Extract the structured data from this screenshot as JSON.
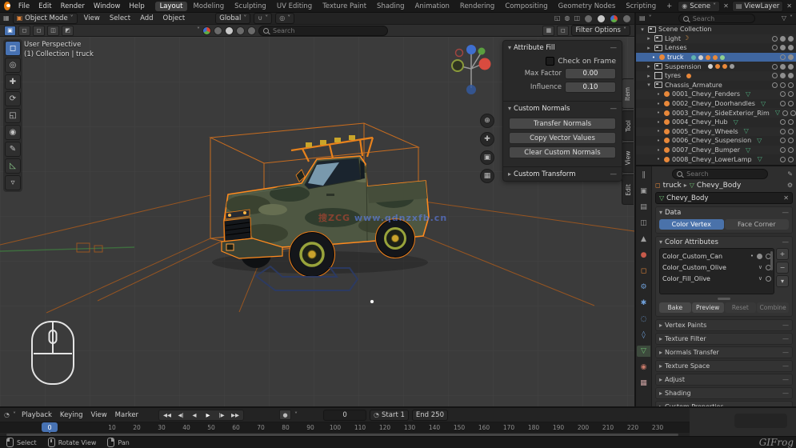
{
  "colors": {
    "accent_blue": "#4772b3",
    "selection_orange": "#ff8a1e",
    "mesh_green": "#6fbf73"
  },
  "icons": {
    "chev": "˅",
    "drop": "▾",
    "disc_open": "▾",
    "disc_closed": "▸",
    "dot": "•",
    "close": "✕",
    "plus": "+",
    "minus": "−",
    "dash": "—",
    "mesh": "▽",
    "moon": "☽",
    "check": "∨",
    "gear": "⚙",
    "pencil": "✎",
    "grid": "▦",
    "square": "▣",
    "layers": "▤",
    "panel": "◫",
    "tri": "▲",
    "circle": "●",
    "ring": "◌",
    "diamond": "◊",
    "sphereglyph": "◉",
    "star": "✱",
    "bars": "∥",
    "boxsel": "◻",
    "cursor": "◎",
    "move": "✚",
    "rotate": "⟳",
    "scale": "◱",
    "transform": "◉",
    "annotate": "✎",
    "measure": "◺",
    "addcube": "▿",
    "zoom": "⊕",
    "pan": "✚",
    "camera": "▣",
    "ortho": "▦",
    "jump_start": "◀◀",
    "prev_key": "◀|",
    "play_back": "◀",
    "play": "▶",
    "next_key": "|▶",
    "jump_end": "▶▶",
    "record": "●",
    "xray": "◫",
    "gizmo_toggle": "◱",
    "overlays": "◍",
    "magnet": "∪",
    "prop_edit": "◎",
    "clock": "◔",
    "filter": "▽",
    "handle": "≡"
  },
  "topbar": {
    "menus": [
      "File",
      "Edit",
      "Render",
      "Window",
      "Help"
    ],
    "tabs": [
      "Layout",
      "Modeling",
      "Sculpting",
      "UV Editing",
      "Texture Paint",
      "Shading",
      "Animation",
      "Rendering",
      "Compositing",
      "Geometry Nodes",
      "Scripting"
    ],
    "add_tab": "+",
    "scene_label": "Scene",
    "view_layer_label": "ViewLayer"
  },
  "viewport_header": {
    "mode": "Object Mode",
    "menus": [
      "View",
      "Select",
      "Add",
      "Object"
    ],
    "orientation": "Global"
  },
  "tool_settings": {
    "search_placeholder": "Search",
    "filter_label": "Filter Options"
  },
  "viewport": {
    "view_label": "User Perspective",
    "collection_label": "(1) Collection | truck",
    "watermark_cn": "搜ZCG",
    "watermark_url": "www.qdnzxfb.cn",
    "npanel_tabs": [
      "Item",
      "Tool",
      "View",
      "Edit"
    ]
  },
  "float_panel": {
    "section1": {
      "title": "Attribute Fill",
      "checkbox_label": "Check on Frame",
      "fields": [
        {
          "label": "Max Factor",
          "value": "0.00"
        },
        {
          "label": "Influence",
          "value": "0.10"
        }
      ]
    },
    "section2": {
      "title": "Custom Normals",
      "buttons": [
        "Transfer Normals",
        "Copy Vector Values",
        "Clear Custom Normals"
      ]
    },
    "section3": {
      "title": "Custom Transform"
    }
  },
  "outliner": {
    "search_placeholder": "Search",
    "rows": [
      {
        "label": "Scene Collection"
      },
      {
        "label": "Light"
      },
      {
        "label": "Lenses"
      },
      {
        "label": "truck"
      },
      {
        "label": "Suspension"
      },
      {
        "label": "tyres"
      },
      {
        "label": "Chassis_Armature"
      },
      {
        "label": "0001_Chevy_Fenders"
      },
      {
        "label": "0002_Chevy_Doorhandles"
      },
      {
        "label": "0003_Chevy_SideExterior_Rim"
      },
      {
        "label": "0004_Chevy_Hub"
      },
      {
        "label": "0005_Chevy_Wheels"
      },
      {
        "label": "0006_Chevy_Suspension"
      },
      {
        "label": "0007_Chevy_Bumper"
      },
      {
        "label": "0008_Chevy_LowerLamp"
      }
    ]
  },
  "properties": {
    "search_placeholder": "Search",
    "breadcrumb_object": "truck",
    "breadcrumb_data": "Chevy_Body",
    "name_field": "Chevy_Body",
    "section_data": {
      "title": "Data",
      "segments": [
        "Color Vertex",
        "Face Corner"
      ]
    },
    "section_attributes": {
      "title": "Color Attributes",
      "items": [
        "Color_Custom_Can",
        "Color_Custom_Olive",
        "Color_Fill_Olive"
      ],
      "buttons": [
        "Bake",
        "Preview",
        "Reset",
        "Combine"
      ]
    },
    "collapsed_sections": [
      "Vertex Paints",
      "Texture Filter",
      "Normals Transfer",
      "Texture Space",
      "Adjust",
      "Shading",
      "Custom Properties"
    ]
  },
  "timeline": {
    "menus": [
      "Playback",
      "Keying",
      "View",
      "Marker"
    ],
    "current_frame": "0",
    "start_label": "Start 1",
    "end_label": "End 250",
    "playhead_label": "0",
    "ticks": [
      "10",
      "20",
      "30",
      "40",
      "50",
      "60",
      "70",
      "80",
      "90",
      "100",
      "110",
      "120",
      "130",
      "140",
      "150",
      "160",
      "170",
      "180",
      "190",
      "200",
      "210",
      "220",
      "230"
    ]
  },
  "statusbar": {
    "hints": [
      {
        "label": "Select"
      },
      {
        "label": "Rotate View"
      },
      {
        "label": "Pan"
      }
    ],
    "watermark": "GIFrog"
  }
}
